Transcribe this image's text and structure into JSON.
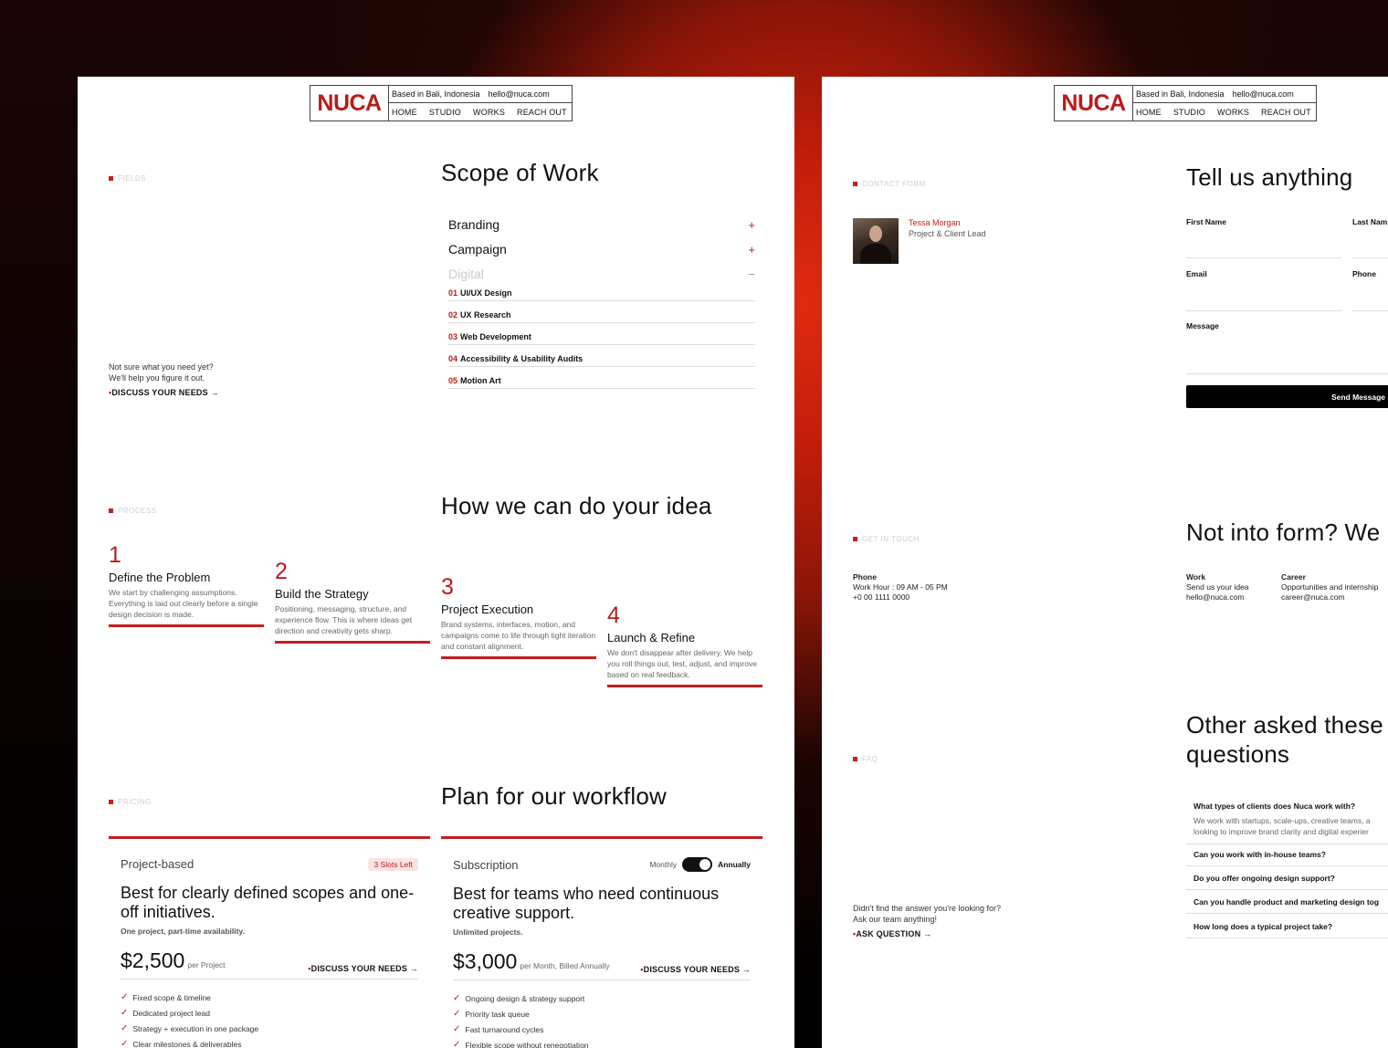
{
  "nav": {
    "logo": "NUCA",
    "location": "Based in Bali, Indonesia",
    "email": "hello@nuca.com",
    "links": [
      "HOME",
      "STUDIO",
      "WORKS",
      "REACH OUT"
    ]
  },
  "fields": {
    "label": "FIELDS",
    "title": "Scope of Work",
    "note_line1": "Not sure what you need yet?",
    "note_line2": "We'll help you figure it out.",
    "cta": "DISCUSS YOUR NEEDS",
    "items": [
      {
        "label": "Branding",
        "toggle": "+"
      },
      {
        "label": "Campaign",
        "toggle": "+"
      },
      {
        "label": "Digital",
        "toggle": "−"
      }
    ],
    "sub_items": [
      {
        "num": "01",
        "label": "UI/UX Design"
      },
      {
        "num": "02",
        "label": "UX Research"
      },
      {
        "num": "03",
        "label": "Web Development"
      },
      {
        "num": "04",
        "label": "Accessibility & Usability Audits"
      },
      {
        "num": "05",
        "label": "Motion Art"
      }
    ]
  },
  "process": {
    "label": "PROCESS",
    "title": "How we can do your idea",
    "steps": [
      {
        "num": "1",
        "title": "Define the Problem",
        "desc": "We start by challenging assumptions. Everything is laid out clearly before a single design decision is made."
      },
      {
        "num": "2",
        "title": "Build the Strategy",
        "desc": "Positioning, messaging, structure, and experience flow. This is where ideas get direction and creativity gets sharp."
      },
      {
        "num": "3",
        "title": "Project Execution",
        "desc": "Brand systems, interfaces, motion, and campaigns come to life through tight iteration and constant alignment."
      },
      {
        "num": "4",
        "title": "Launch & Refine",
        "desc": "We don't disappear after delivery. We help you roll things out, test, adjust, and improve based on real feedback."
      }
    ]
  },
  "pricing": {
    "label": "PRICING",
    "title": "Plan for our workflow",
    "plans": [
      {
        "type": "Project-based",
        "badge": "3 Slots Left",
        "title": "Best for clearly defined scopes and one-off initiatives.",
        "sub": "One project, part-time availability.",
        "price": "$2,500",
        "per": "per Project",
        "cta": "DISCUSS YOUR NEEDS",
        "features": [
          "Fixed scope & timeline",
          "Dedicated project lead",
          "Strategy + execution in one package",
          "Clear milestones & deliverables"
        ]
      },
      {
        "type": "Subscription",
        "toggle_left": "Monthly",
        "toggle_right": "Annually",
        "title": "Best for teams who need continuous creative support.",
        "sub": "Unlimited projects.",
        "price": "$3,000",
        "per": "per Month, Billed Annually",
        "cta": "DISCUSS YOUR NEEDS",
        "features": [
          "Ongoing design & strategy support",
          "Priority task queue",
          "Fast turnaround cycles",
          "Flexible scope without renegotiation"
        ]
      }
    ]
  },
  "contact": {
    "label": "CONTACT FORM",
    "title": "Tell us anything",
    "person_name": "Tessa Morgan",
    "person_role": "Project & Client Lead",
    "fields": {
      "first_name": "First Name",
      "last_name": "Last Nam",
      "email": "Email",
      "phone": "Phone",
      "message": "Message"
    },
    "send": "Send Message"
  },
  "touch": {
    "label": "GET IN TOUCH",
    "title": "Not into form? We",
    "phone_title": "Phone",
    "phone_hours": "Work Hour : 09 AM - 05 PM",
    "phone_number": "+0 00 1111 0000",
    "work_title": "Work",
    "work_desc": "Send us your idea",
    "work_email": "hello@nuca.com",
    "career_title": "Career",
    "career_desc": "Opportunities and internship",
    "career_email": "career@nuca.com"
  },
  "faq": {
    "label": "FAQ",
    "title_line1": "Other asked these",
    "title_line2": "questions",
    "note_line1": "Didn't find the answer you're looking for?",
    "note_line2": "Ask our team anything!",
    "cta": "ASK QUESTION",
    "items": [
      {
        "q": "What types of clients does Nuca work with?",
        "a1": "We work with startups, scale-ups, creative teams, a",
        "a2": "looking to improve brand clarity and digital experier"
      },
      {
        "q": "Can you work with in-house teams?"
      },
      {
        "q": "Do you offer ongoing design support?"
      },
      {
        "q": "Can you handle product and marketing design tog"
      },
      {
        "q": "How long does a typical project take?"
      }
    ]
  },
  "icons": {
    "arrow": "→",
    "check": "✓",
    "bullet": "•"
  },
  "colors": {
    "accent": "#c41e1e",
    "background_glow": "#e02a10"
  }
}
